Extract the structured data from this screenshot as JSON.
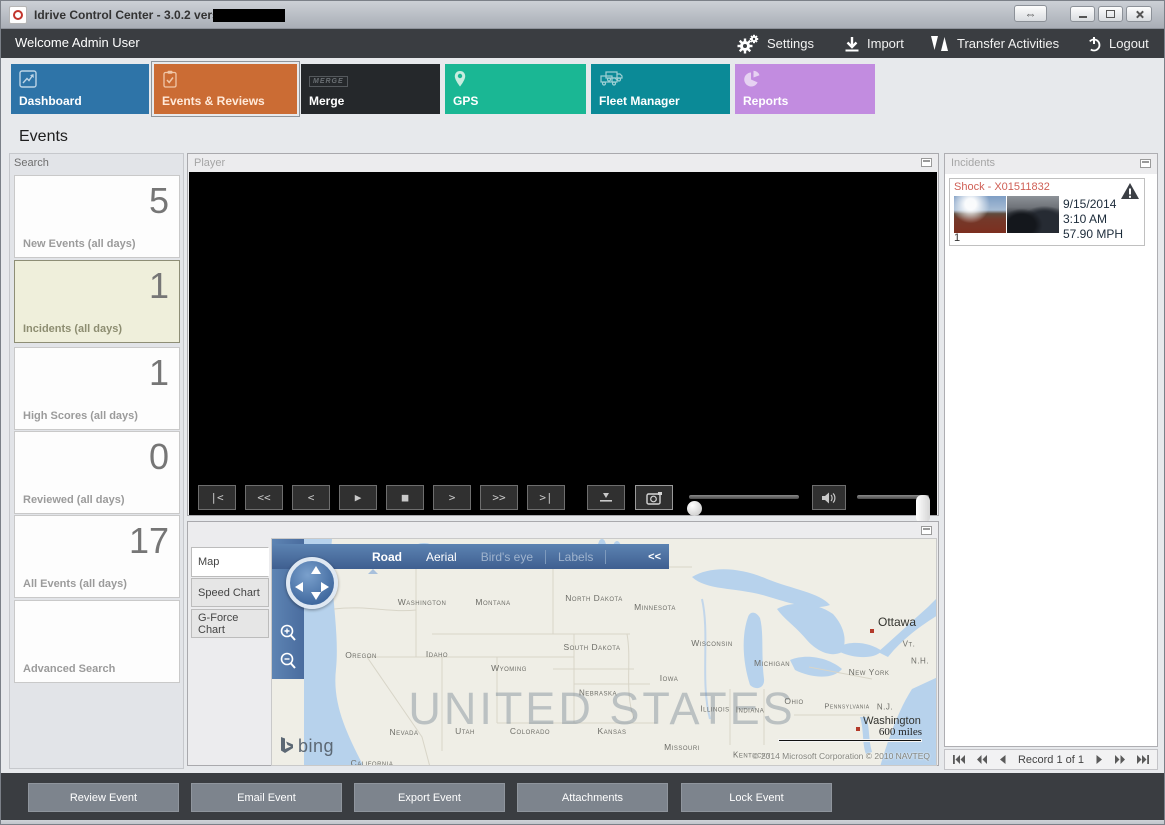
{
  "window": {
    "title": "Idrive Control Center - 3.0.2 version -",
    "resize_glyph": "⇔"
  },
  "header": {
    "welcome": "Welcome Admin User",
    "settings": "Settings",
    "import": "Import",
    "transfer": "Transfer Activities",
    "logout": "Logout"
  },
  "tiles": [
    {
      "label": "Dashboard",
      "color": "#2e74a8",
      "icon": "line-chart-icon"
    },
    {
      "label": "Events & Reviews",
      "color": "#cb6c34",
      "icon": "clipboard-check-icon",
      "selected": true
    },
    {
      "label": "Merge",
      "color": "#25282b",
      "icon": "merge-icon",
      "icon_text": "MERGE"
    },
    {
      "label": "GPS",
      "color": "#1ab794",
      "icon": "map-pin-icon"
    },
    {
      "label": "Fleet Manager",
      "color": "#0b8a97",
      "icon": "trucks-icon"
    },
    {
      "label": "Reports",
      "color": "#c28ce0",
      "icon": "pie-chart-icon"
    }
  ],
  "page_title": "Events",
  "search_panel": {
    "title": "Search",
    "cards": [
      {
        "count": "5",
        "label": "New Events (all days)"
      },
      {
        "count": "1",
        "label": "Incidents (all days)",
        "selected": true
      },
      {
        "count": "1",
        "label": "High Scores (all days)"
      },
      {
        "count": "0",
        "label": "Reviewed (all days)"
      },
      {
        "count": "17",
        "label": "All Events (all days)"
      },
      {
        "count": "",
        "label": "Advanced Search"
      }
    ]
  },
  "player": {
    "title": "Player",
    "buttons": [
      {
        "name": "first",
        "glyph": "|<"
      },
      {
        "name": "rewind",
        "glyph": "<<"
      },
      {
        "name": "step-back",
        "glyph": "<"
      },
      {
        "name": "play",
        "glyph": "▶"
      },
      {
        "name": "stop",
        "glyph": "■"
      },
      {
        "name": "step-forward",
        "glyph": ">"
      },
      {
        "name": "fast-forward",
        "glyph": ">>"
      },
      {
        "name": "last",
        "glyph": ">|"
      }
    ]
  },
  "incidents_panel": {
    "title": "Incidents",
    "items": [
      {
        "title": "Shock - X01511832",
        "date": "9/15/2014",
        "time": "3:10 AM",
        "speed": "57.90 MPH",
        "count": "1"
      }
    ]
  },
  "map_panel": {
    "tabs": [
      {
        "label": "Map",
        "active": true
      },
      {
        "label": "Speed Chart"
      },
      {
        "label": "G-Force Chart"
      }
    ],
    "nav": {
      "road": "Road",
      "aerial": "Aerial",
      "birds_eye": "Bird's eye",
      "labels": "Labels",
      "collapse": "<<"
    },
    "big_label": "UNITED STATES",
    "states": [
      {
        "name": "Washington"
      },
      {
        "name": "Montana"
      },
      {
        "name": "North Dakota"
      },
      {
        "name": "Minnesota"
      },
      {
        "name": "Wisconsin"
      },
      {
        "name": "South Dakota"
      },
      {
        "name": "Oregon"
      },
      {
        "name": "Idaho"
      },
      {
        "name": "Wyoming"
      },
      {
        "name": "Iowa"
      },
      {
        "name": "Nebraska"
      },
      {
        "name": "Michigan"
      },
      {
        "name": "New York"
      },
      {
        "name": "Vt."
      },
      {
        "name": "N.H."
      },
      {
        "name": "Ohio"
      },
      {
        "name": "Pennsylvania"
      },
      {
        "name": "N.J."
      },
      {
        "name": "Illinois"
      },
      {
        "name": "Indiana"
      },
      {
        "name": "Nevada"
      },
      {
        "name": "Utah"
      },
      {
        "name": "Colorado"
      },
      {
        "name": "Kansas"
      },
      {
        "name": "Missouri"
      },
      {
        "name": "Kentucky"
      },
      {
        "name": "California"
      }
    ],
    "cities": [
      {
        "name": "Ottawa"
      },
      {
        "name": "Washington"
      }
    ],
    "scale_label": "600 miles",
    "copyright": "© 2014 Microsoft Corporation  © 2010 NAVTEQ",
    "logo_text": "bing"
  },
  "record_nav": {
    "label": "Record 1 of 1"
  },
  "footer": {
    "buttons": [
      "Review Event",
      "Email Event",
      "Export Event",
      "Attachments",
      "Lock Event"
    ]
  },
  "colors": {
    "accent_selected_tile": "#cb6c34",
    "incident_title_red": "#cf5f55",
    "dark_bar": "#3a3d41",
    "map_water": "#b7d2ec",
    "map_land": "#efeee6"
  }
}
